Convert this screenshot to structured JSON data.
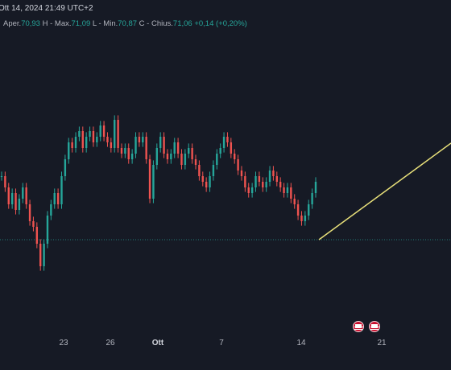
{
  "header": {
    "datetime": "Ott 14, 2024 21:49 UTC+2",
    "open_label": "Aper.",
    "open_value": "70,93",
    "high_label": "H - Max.",
    "high_value": "71,09",
    "low_label": "L - Min.",
    "low_value": "70,87",
    "close_label": "C - Chius.",
    "close_value": "71,06",
    "change": "+0,14 (+0,20%)"
  },
  "x_axis": {
    "ticks": [
      "23",
      "26",
      "Ott",
      "7",
      "14",
      "21"
    ]
  },
  "events": [
    {
      "icon": "us-flag-icon"
    },
    {
      "icon": "us-flag-icon"
    }
  ],
  "chart_data": {
    "type": "line",
    "series": [
      {
        "values": [
          71.2,
          71.0,
          70.7,
          70.9,
          70.6,
          70.8,
          71.0,
          70.7,
          70.4,
          70.3,
          70.0,
          69.6,
          70.0,
          70.5,
          70.7,
          70.9,
          70.7,
          71.2,
          71.5,
          71.8,
          71.7,
          71.9,
          72.0,
          71.7,
          71.9,
          72.0,
          71.8,
          71.9,
          72.1,
          71.9,
          71.8,
          71.7,
          72.2,
          71.7,
          71.6,
          71.7,
          71.5,
          71.6,
          71.9,
          71.8,
          71.9,
          71.5,
          70.8,
          71.4,
          71.7,
          71.9,
          71.6,
          71.5,
          71.6,
          71.8,
          71.6,
          71.4,
          71.6,
          71.7,
          71.5,
          71.4,
          71.2,
          71.1,
          71.0,
          71.2,
          71.4,
          71.6,
          71.7,
          71.9,
          71.8,
          71.6,
          71.5,
          71.3,
          71.2,
          71.0,
          70.9,
          71.0,
          71.2,
          71.1,
          71.0,
          71.1,
          71.3,
          71.2,
          71.1,
          71.0,
          70.9,
          71.0,
          70.8,
          70.7,
          70.5,
          70.4,
          70.5,
          70.7,
          70.9,
          71.1
        ]
      }
    ],
    "trend_line": {
      "color": "#e8e07a"
    },
    "colors": {
      "up": "#26a69a",
      "down": "#ef5350",
      "background": "#161a25"
    }
  }
}
